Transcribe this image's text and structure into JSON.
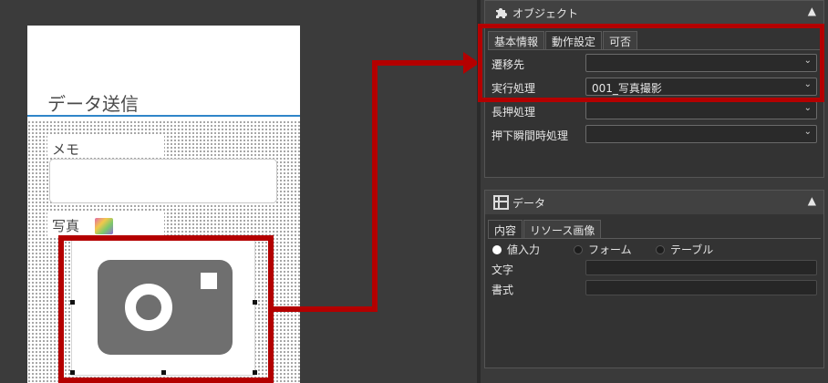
{
  "canvas": {
    "page_title": "データ送信",
    "memo_label": "メモ",
    "photo_label": "写真"
  },
  "object_panel": {
    "title": "オブジェクト",
    "tabs": [
      "基本情報",
      "動作設定",
      "可否"
    ],
    "active_tab": "動作設定",
    "rows": [
      {
        "label": "遷移先",
        "value": ""
      },
      {
        "label": "実行処理",
        "value": "001_写真撮影"
      },
      {
        "label": "長押処理",
        "value": ""
      },
      {
        "label": "押下瞬間時処理",
        "value": ""
      }
    ]
  },
  "data_panel": {
    "title": "データ",
    "tabs": [
      "内容",
      "リソース画像"
    ],
    "active_tab": "内容",
    "radios": [
      {
        "label": "値入力",
        "selected": true
      },
      {
        "label": "フォーム",
        "selected": false
      },
      {
        "label": "テーブル",
        "selected": false
      }
    ],
    "fields": [
      {
        "label": "文字",
        "value": ""
      },
      {
        "label": "書式",
        "value": ""
      }
    ]
  },
  "colors": {
    "highlight": "#b40000",
    "title_underline": "#2f86c9",
    "panel_bg": "#333333"
  },
  "icons": {
    "object_panel": "puzzle-icon",
    "data_panel": "table-icon",
    "photo": "camera-icon",
    "collapse": "chevron-up-icon",
    "select": "chevron-down-icon"
  }
}
